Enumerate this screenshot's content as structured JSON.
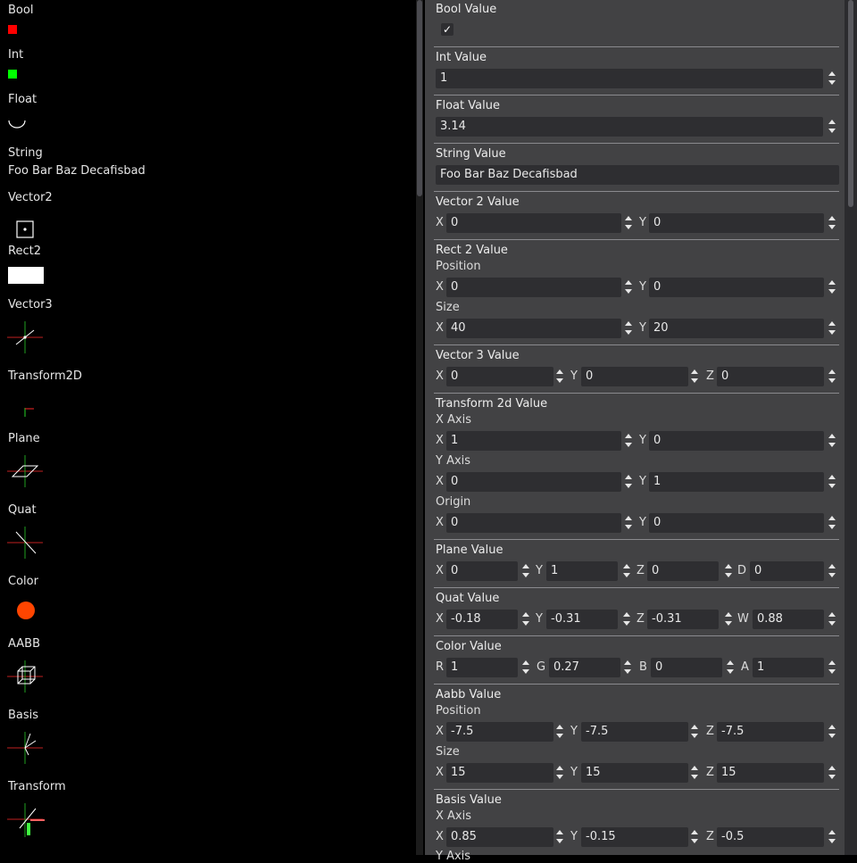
{
  "left": {
    "bool_label": "Bool",
    "int_label": "Int",
    "float_label": "Float",
    "string_label": "String",
    "string_value": "Foo Bar Baz Decafisbad",
    "vector2_label": "Vector2",
    "rect2_label": "Rect2",
    "vector3_label": "Vector3",
    "transform2d_label": "Transform2D",
    "plane_label": "Plane",
    "quat_label": "Quat",
    "color_label": "Color",
    "aabb_label": "AABB",
    "basis_label": "Basis",
    "transform_label": "Transform",
    "colors": {
      "bool": "#ff0000",
      "int": "#00ff00",
      "color": "#ff4500"
    }
  },
  "inspector": {
    "bool": {
      "title": "Bool Value",
      "checked": "✓"
    },
    "int": {
      "title": "Int Value",
      "value": "1"
    },
    "float": {
      "title": "Float Value",
      "value": "3.14"
    },
    "string": {
      "title": "String Value",
      "value": "Foo Bar Baz Decafisbad"
    },
    "vector2": {
      "title": "Vector 2 Value",
      "x_label": "X",
      "x": "0",
      "y_label": "Y",
      "y": "0"
    },
    "rect2": {
      "title": "Rect 2 Value",
      "position_label": "Position",
      "px_label": "X",
      "px": "0",
      "py_label": "Y",
      "py": "0",
      "size_label": "Size",
      "sx_label": "X",
      "sx": "40",
      "sy_label": "Y",
      "sy": "20"
    },
    "vector3": {
      "title": "Vector 3 Value",
      "x_label": "X",
      "x": "0",
      "y_label": "Y",
      "y": "0",
      "z_label": "Z",
      "z": "0"
    },
    "transform2d": {
      "title": "Transform 2d Value",
      "xaxis_label": "X Axis",
      "xx_label": "X",
      "xx": "1",
      "xy_label": "Y",
      "xy": "0",
      "yaxis_label": "Y Axis",
      "yx_label": "X",
      "yx": "0",
      "yy_label": "Y",
      "yy": "1",
      "origin_label": "Origin",
      "ox_label": "X",
      "ox": "0",
      "oy_label": "Y",
      "oy": "0"
    },
    "plane": {
      "title": "Plane Value",
      "x_label": "X",
      "x": "0",
      "y_label": "Y",
      "y": "1",
      "z_label": "Z",
      "z": "0",
      "d_label": "D",
      "d": "0"
    },
    "quat": {
      "title": "Quat Value",
      "x_label": "X",
      "x": "-0.18",
      "y_label": "Y",
      "y": "-0.31",
      "z_label": "Z",
      "z": "-0.31",
      "w_label": "W",
      "w": "0.88"
    },
    "color": {
      "title": "Color Value",
      "r_label": "R",
      "r": "1",
      "g_label": "G",
      "g": "0.27",
      "b_label": "B",
      "b": "0",
      "a_label": "A",
      "a": "1"
    },
    "aabb": {
      "title": "Aabb Value",
      "position_label": "Position",
      "px_label": "X",
      "px": "-7.5",
      "py_label": "Y",
      "py": "-7.5",
      "pz_label": "Z",
      "pz": "-7.5",
      "size_label": "Size",
      "sx_label": "X",
      "sx": "15",
      "sy_label": "Y",
      "sy": "15",
      "sz_label": "Z",
      "sz": "15"
    },
    "basis": {
      "title": "Basis Value",
      "xaxis_label": "X Axis",
      "xx_label": "X",
      "xx": "0.85",
      "xy_label": "Y",
      "xy": "-0.15",
      "xz_label": "Z",
      "xz": "-0.5",
      "yaxis_label": "Y Axis"
    }
  }
}
